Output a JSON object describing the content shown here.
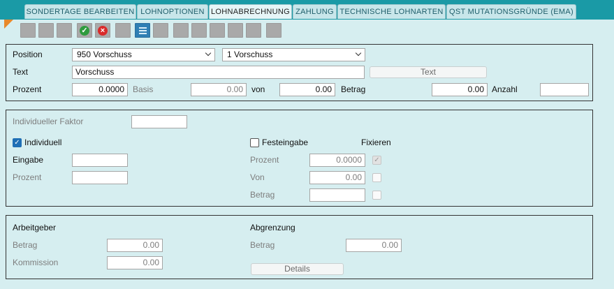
{
  "tabs": [
    {
      "label": "SONDERTAGE BEARBEITEN"
    },
    {
      "label": "LOHNOPTIONEN"
    },
    {
      "label": "LOHNABRECHNUNG"
    },
    {
      "label": "ZAHLUNG"
    },
    {
      "label": "TECHNISCHE LOHNARTEN"
    },
    {
      "label": "QST MUTATIONSGRÜNDE (EMA)"
    }
  ],
  "active_tab": "LOHNABRECHNUNG",
  "toolbar": {
    "buttons": [
      "blank",
      "blank",
      "blank",
      "confirm-icon",
      "cancel-icon",
      "blank",
      "list-icon",
      "blank",
      "blank",
      "blank",
      "blank",
      "blank",
      "blank",
      "blank"
    ],
    "colors": {
      "confirm": "#2e9b3e",
      "cancel": "#d92b2b",
      "list": "#2f7fb4"
    }
  },
  "position_panel": {
    "position_label": "Position",
    "position_select": "950 Vorschuss",
    "sub_select": "1 Vorschuss",
    "text_label": "Text",
    "text_value": "Vorschuss",
    "text_button": "Text",
    "prozent_label": "Prozent",
    "prozent_value": "0.0000",
    "basis_label": "Basis",
    "basis_value": "0.00",
    "von_label": "von",
    "von_value": "0.00",
    "betrag_label": "Betrag",
    "betrag_value": "0.00",
    "anzahl_label": "Anzahl",
    "anzahl_value": ""
  },
  "factor_panel": {
    "individueller_faktor_label": "Individueller Faktor",
    "individueller_faktor_value": "",
    "individuell_label": "Individuell",
    "individuell_checked": true,
    "eingabe_label": "Eingabe",
    "eingabe_value": "",
    "prozent_label": "Prozent",
    "prozent_value": "",
    "festeingabe_label": "Festeingabe",
    "festeingabe_checked": false,
    "fixieren_label": "Fixieren",
    "fe_prozent_label": "Prozent",
    "fe_prozent_value": "0.0000",
    "fe_von_label": "Von",
    "fe_von_value": "0.00",
    "fe_betrag_label": "Betrag",
    "fe_betrag_value": ""
  },
  "employer_panel": {
    "arbeitgeber_label": "Arbeitgeber",
    "betrag_label": "Betrag",
    "betrag_value": "0.00",
    "kommission_label": "Kommission",
    "kommission_value": "0.00",
    "abgrenzung_label": "Abgrenzung",
    "ab_betrag_label": "Betrag",
    "ab_betrag_value": "0.00",
    "details_button": "Details"
  }
}
